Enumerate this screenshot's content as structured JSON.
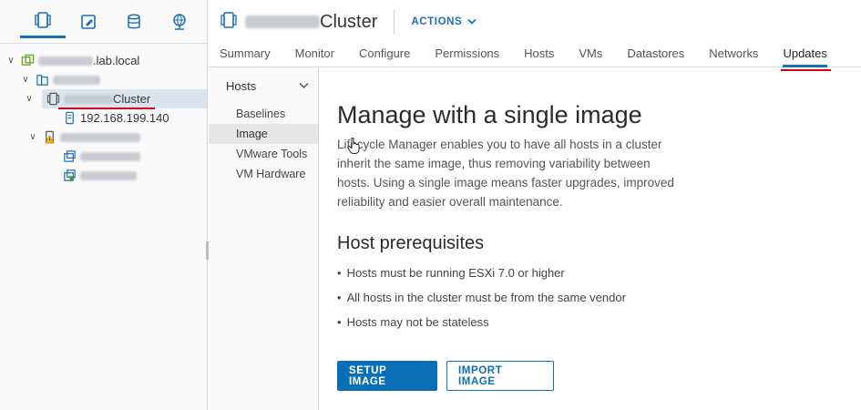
{
  "left_panel": {
    "nav_icons": [
      "hosts-and-clusters-icon",
      "vms-and-templates-icon",
      "storage-icon",
      "networking-icon"
    ],
    "tree": {
      "vcenter_suffix": ".lab.local",
      "cluster_suffix": "Cluster",
      "host_ip": "192.168.199.140"
    }
  },
  "header": {
    "title_suffix": "Cluster",
    "actions_label": "ACTIONS"
  },
  "tabs": [
    "Summary",
    "Monitor",
    "Configure",
    "Permissions",
    "Hosts",
    "VMs",
    "Datastores",
    "Networks",
    "Updates"
  ],
  "subnav": {
    "section_label": "Hosts",
    "items": [
      "Baselines",
      "Image",
      "VMware Tools",
      "VM Hardware"
    ]
  },
  "main": {
    "heading": "Manage with a single image",
    "description": "Lifecycle Manager enables you to have all hosts in a cluster inherit the same image, thus removing variability between hosts. Using a single image means faster upgrades, improved reliability and easier overall maintenance.",
    "prereq_heading": "Host prerequisites",
    "prerequisites": [
      "Hosts must be running ESXi 7.0 or higher",
      "All hosts in the cluster must be from the same vendor",
      "Hosts may not be stateless"
    ],
    "setup_button": "SETUP IMAGE",
    "import_button": "IMPORT IMAGE"
  },
  "colors": {
    "accent": "#1b6fb8",
    "highlight_underline": "#d0021b",
    "selected_row": "#d9e4ef"
  }
}
